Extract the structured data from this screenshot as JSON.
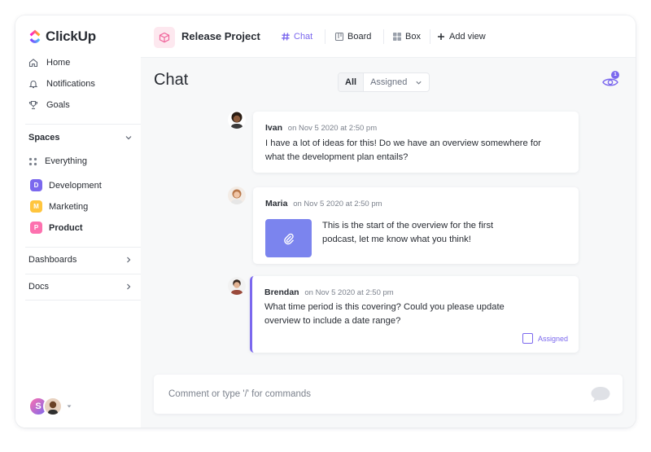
{
  "app": {
    "logo_text": "ClickUp"
  },
  "sidebar": {
    "nav": [
      {
        "label": "Home",
        "icon": "home-icon"
      },
      {
        "label": "Notifications",
        "icon": "bell-icon"
      },
      {
        "label": "Goals",
        "icon": "trophy-icon"
      }
    ],
    "spaces_label": "Spaces",
    "everything_label": "Everything",
    "spaces": [
      {
        "badge": "D",
        "label": "Development",
        "color": "#7b68ee"
      },
      {
        "badge": "M",
        "label": "Marketing",
        "color": "#ffc53d"
      },
      {
        "badge": "P",
        "label": "Product",
        "color": "#fd71af"
      }
    ],
    "dashboards_label": "Dashboards",
    "docs_label": "Docs",
    "user_initial": "S"
  },
  "header": {
    "project_title": "Release Project",
    "views": [
      {
        "label": "Chat",
        "icon": "hash-icon",
        "active": true
      },
      {
        "label": "Board",
        "icon": "board-icon",
        "active": false
      },
      {
        "label": "Box",
        "icon": "grid-icon",
        "active": false
      }
    ],
    "add_view_label": "Add view"
  },
  "chat": {
    "title": "Chat",
    "filter_all": "All",
    "filter_assigned": "Assigned",
    "watchers_count": "1",
    "messages": [
      {
        "author": "Ivan",
        "time": "on Nov 5 2020 at 2:50 pm",
        "text_line1": "I have a lot of ideas for this! Do we have an overview somewhere for",
        "text_line2": "what the development plan entails?"
      },
      {
        "author": "Maria",
        "time": "on Nov 5 2020 at 2:50 pm",
        "text_line1": "This is the start of the overview for the first",
        "text_line2": "podcast, let me know what you think!"
      },
      {
        "author": "Brendan",
        "time": "on Nov 5 2020 at 2:50 pm",
        "text_line1": "What time period is this covering? Could you please update",
        "text_line2": "overview to include a date range?",
        "assigned_label": "Assigned"
      }
    ],
    "composer_placeholder": "Comment or type '/' for commands"
  },
  "colors": {
    "accent": "#7b68ee",
    "attachment": "#7b84ee",
    "project_icon_bg": "#fde8ef"
  }
}
